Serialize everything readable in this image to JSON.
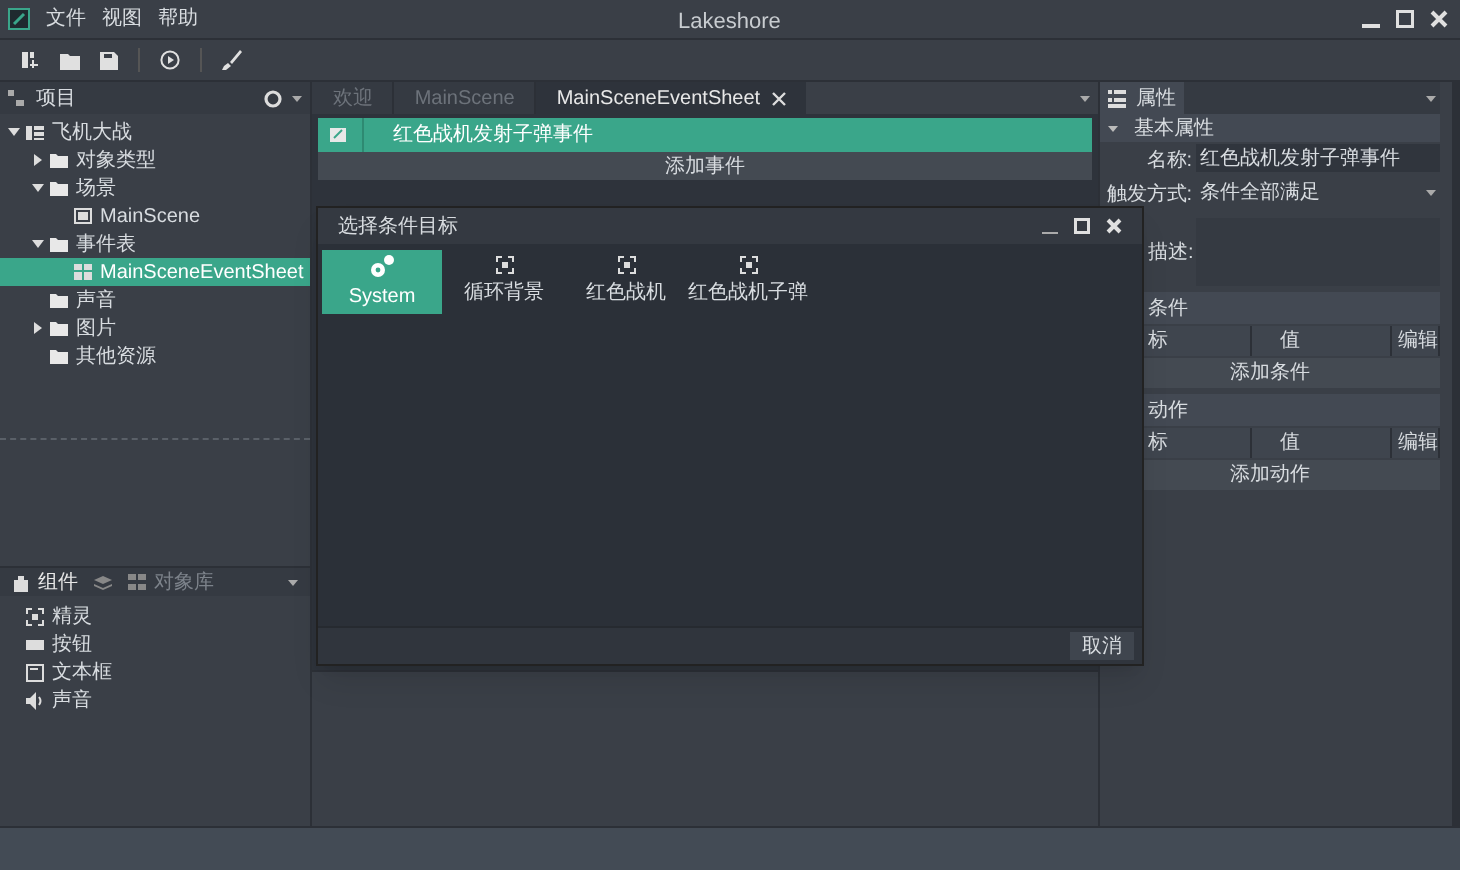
{
  "window": {
    "title": "Lakeshore"
  },
  "menu": [
    "文件",
    "视图",
    "帮助"
  ],
  "project_panel": {
    "title": "项目",
    "tree": [
      {
        "label": "飞机大战",
        "kind": "project",
        "expanded": true,
        "selected": false,
        "children": [
          {
            "label": "对象类型",
            "kind": "folder",
            "expanded": false,
            "selected": false
          },
          {
            "label": "场景",
            "kind": "folder",
            "expanded": true,
            "selected": false,
            "children": [
              {
                "label": "MainScene",
                "kind": "scene",
                "selected": false
              }
            ]
          },
          {
            "label": "事件表",
            "kind": "folder",
            "expanded": true,
            "selected": false,
            "children": [
              {
                "label": "MainSceneEventSheet",
                "kind": "sheet",
                "selected": true
              }
            ]
          },
          {
            "label": "声音",
            "kind": "folder",
            "selected": false
          },
          {
            "label": "图片",
            "kind": "folder",
            "expanded": false,
            "selected": false
          },
          {
            "label": "其他资源",
            "kind": "folder",
            "selected": false
          }
        ]
      }
    ]
  },
  "component_panel": {
    "tabs": [
      {
        "label": "组件",
        "kind": "components",
        "selected": true
      },
      {
        "kind": "layers",
        "selected": false
      },
      {
        "label": "对象库",
        "kind": "library",
        "selected": false
      }
    ],
    "items": [
      {
        "label": "精灵",
        "kind": "sprite"
      },
      {
        "label": "按钮",
        "kind": "button"
      },
      {
        "label": "文本框",
        "kind": "textbox"
      },
      {
        "label": "声音",
        "kind": "sound"
      }
    ]
  },
  "editor_tabs": [
    {
      "label": "欢迎",
      "selected": false
    },
    {
      "label": "MainScene",
      "selected": false
    },
    {
      "label": "MainSceneEventSheet",
      "selected": true,
      "closable": true
    }
  ],
  "events": [
    {
      "label": "红色战机发射子弹事件",
      "selected": true
    }
  ],
  "add_event_button": "添加事件",
  "dialog": {
    "title": "选择条件目标",
    "targets": [
      {
        "label": "System",
        "kind": "system",
        "selected": true
      },
      {
        "label": "循环背景",
        "kind": "object",
        "selected": false
      },
      {
        "label": "红色战机",
        "kind": "object",
        "selected": false
      },
      {
        "label": "红色战机子弹",
        "kind": "object",
        "selected": false
      }
    ],
    "cancel_button": "取消"
  },
  "properties_panel": {
    "title": "属性",
    "group": {
      "label": "基本属性",
      "expanded": true
    },
    "fields": [
      {
        "label": "名称:",
        "value": "红色战机发射子弹事件",
        "kind": "text"
      },
      {
        "label": "触发方式:",
        "value": "条件全部满足",
        "kind": "dropdown"
      },
      {
        "label": "描述:",
        "kind": "textarea"
      }
    ],
    "sections": [
      {
        "title": "条件",
        "columns": [
          "标",
          "值",
          "编辑"
        ],
        "add_button": "添加条件"
      },
      {
        "title": "动作",
        "columns": [
          "标",
          "值",
          "编辑"
        ],
        "add_button": "添加动作"
      }
    ]
  }
}
